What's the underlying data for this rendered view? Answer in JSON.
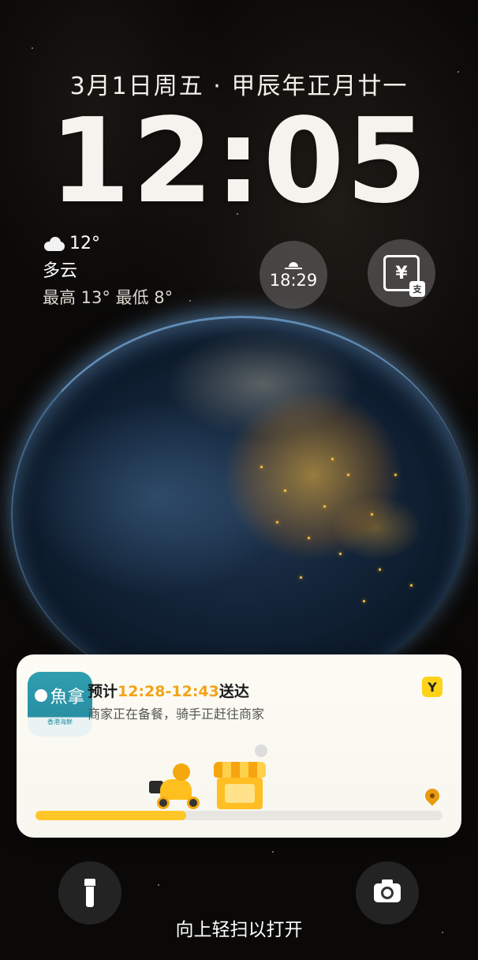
{
  "lockscreen": {
    "date": "3月1日周五 · 甲辰年正月廿一",
    "time": "12:05",
    "unlock_hint": "向上轻扫以打开"
  },
  "weather": {
    "icon": "cloud-icon",
    "temperature": "12°",
    "condition": "多云",
    "range": "最高 13° 最低 8°"
  },
  "widgets": {
    "sunset": {
      "icon": "sunset-icon",
      "time": "18:29"
    },
    "payment": {
      "icon": "yuan-payment-icon",
      "glyph": "¥",
      "badge": "支"
    }
  },
  "notification": {
    "app_logo_text": "魚拿",
    "app_logo_sub": "香港海鮮",
    "title_prefix": "预计",
    "title_time": "12:28-12:43",
    "title_suffix": "送达",
    "description": "商家正在备餐，骑手正赶往商家",
    "mascot": "Y",
    "progress": 0.37,
    "accent_color": "#f1a317"
  },
  "quick_actions": {
    "flashlight": "flashlight-icon",
    "camera": "camera-icon"
  }
}
